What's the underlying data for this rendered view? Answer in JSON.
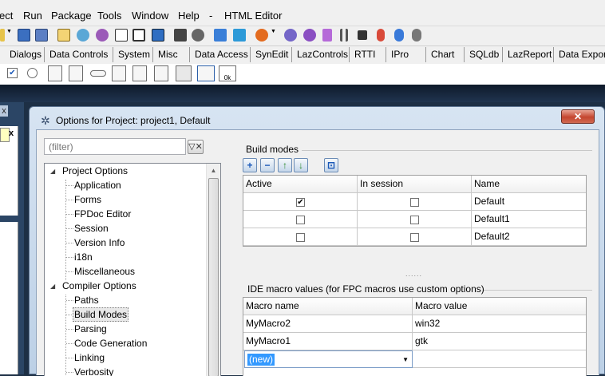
{
  "menubar": {
    "items": [
      "ect",
      "Run",
      "Package",
      "Tools",
      "Window",
      "Help",
      "-",
      "HTML Editor"
    ]
  },
  "palette": {
    "tabs": [
      "Dialogs",
      "Data Controls",
      "System",
      "Misc",
      "Data Access",
      "SynEdit",
      "LazControls",
      "RTTI",
      "IPro",
      "Chart",
      "SQLdb",
      "LazReport",
      "Data Expor"
    ]
  },
  "left_partial": {
    "close_glyph": "x"
  },
  "dialog": {
    "title": "Options for Project: project1, Default",
    "close_glyph": "✕",
    "filter_placeholder": "(filter)",
    "tree": {
      "nodes": [
        {
          "label": "Project Options",
          "level": 0,
          "expanded": true
        },
        {
          "label": "Application",
          "level": 1
        },
        {
          "label": "Forms",
          "level": 1
        },
        {
          "label": "FPDoc Editor",
          "level": 1
        },
        {
          "label": "Session",
          "level": 1
        },
        {
          "label": "Version Info",
          "level": 1
        },
        {
          "label": "i18n",
          "level": 1
        },
        {
          "label": "Miscellaneous",
          "level": 1
        },
        {
          "label": "Compiler Options",
          "level": 0,
          "expanded": true
        },
        {
          "label": "Paths",
          "level": 1
        },
        {
          "label": "Build Modes",
          "level": 1,
          "selected": true
        },
        {
          "label": "Parsing",
          "level": 1
        },
        {
          "label": "Code Generation",
          "level": 1
        },
        {
          "label": "Linking",
          "level": 1
        },
        {
          "label": "Verbosity",
          "level": 1
        }
      ]
    },
    "build_modes": {
      "title": "Build modes",
      "toolbar": [
        "+",
        "−",
        "↑",
        "↓",
        "⊡"
      ],
      "columns": [
        "Active",
        "In session",
        "Name"
      ],
      "rows": [
        {
          "active": true,
          "in_session": false,
          "name": "Default"
        },
        {
          "active": false,
          "in_session": false,
          "name": "Default1"
        },
        {
          "active": false,
          "in_session": false,
          "name": "Default2"
        }
      ]
    },
    "splitter_dots": "......",
    "macros": {
      "title": "IDE macro values (for FPC macros use custom options)",
      "columns": [
        "Macro name",
        "Macro value"
      ],
      "rows": [
        {
          "name": "MyMacro2",
          "value": "win32"
        },
        {
          "name": "MyMacro1",
          "value": "gtk"
        }
      ],
      "new_value": "(new)"
    }
  }
}
